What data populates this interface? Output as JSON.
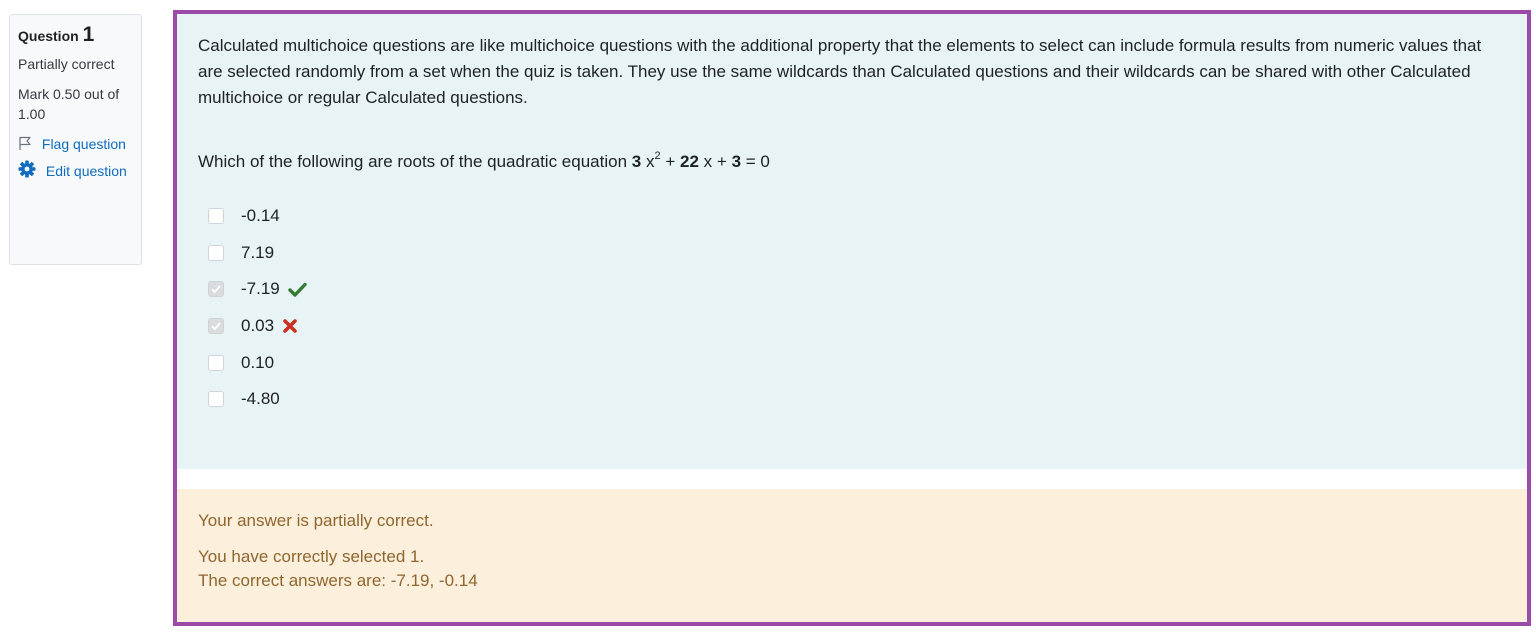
{
  "info": {
    "question_label": "Question",
    "question_number": "1",
    "state": "Partially correct",
    "grade": "Mark 0.50 out of 1.00",
    "flag_label": "Flag question",
    "edit_label": "Edit question"
  },
  "question": {
    "intro": "Calculated multichoice questions are like multichoice questions with the additional property that the elements to select can include formula results from numeric values that are selected randomly from a set when the quiz is taken. They use the same wildcards than Calculated questions and their wildcards can be shared with other Calculated multichoice or regular Calculated questions.",
    "prompt_prefix": "Which of the following are roots of the quadratic equation",
    "coef_a": "3",
    "var1": "x",
    "exponent": "2",
    "plus1": "+",
    "coef_b": "22",
    "var2": "x",
    "plus2": "+",
    "coef_c": "3",
    "equals": "= 0",
    "options": [
      {
        "label": "-0.14",
        "checked": false,
        "mark": ""
      },
      {
        "label": "7.19",
        "checked": false,
        "mark": ""
      },
      {
        "label": "-7.19",
        "checked": true,
        "mark": "correct-icon"
      },
      {
        "label": "0.03",
        "checked": true,
        "mark": "incorrect-icon"
      },
      {
        "label": "0.10",
        "checked": false,
        "mark": ""
      },
      {
        "label": "-4.80",
        "checked": false,
        "mark": ""
      }
    ]
  },
  "feedback": {
    "specific": "Your answer is partially correct.",
    "correct_count": "You have correctly selected 1.",
    "right_answer": "The correct answers are: -7.19, -0.14"
  },
  "colors": {
    "frame": "#9b4aa8",
    "formulation_bg": "#e7f3f5",
    "outcome_bg": "#fcefdc",
    "outcome_text": "#8e662e",
    "correct": "#357a32",
    "incorrect": "#ca3120",
    "link": "#0f6cbf"
  }
}
